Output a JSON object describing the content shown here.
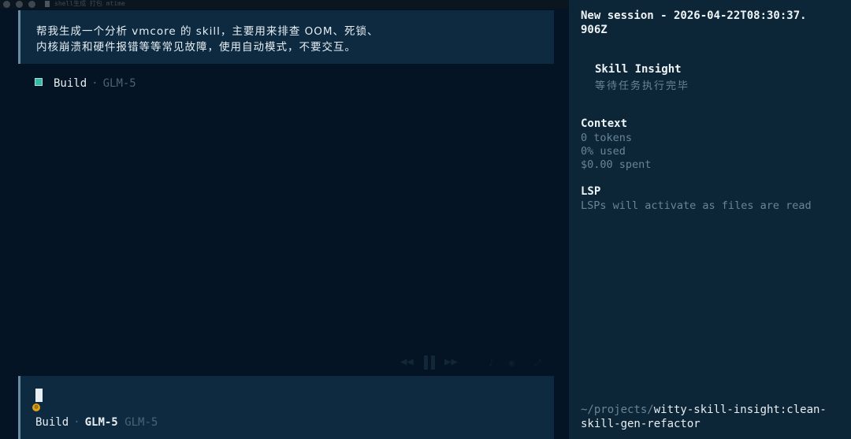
{
  "window": {
    "tab_title": "shell生成 打包 mtime"
  },
  "conversation": {
    "prompt_line1": "帮我生成一个分析 vmcore 的 skill，主要用来排查 OOM、死锁、",
    "prompt_line2": "内核崩溃和硬件报错等等常见故障，使用自动模式，不要交互。",
    "agent_mode": "Build",
    "separator": "·",
    "model": "GLM-5"
  },
  "input": {
    "mode": "Build",
    "separator": "·",
    "model": "GLM-5",
    "model_alt": "GLM-5"
  },
  "sidebar": {
    "session_title_line1": "New session - 2026-04-22T08:30:37.",
    "session_title_line2": "906Z",
    "insight_title": "Skill Insight",
    "insight_status": "等待任务执行完毕",
    "context_heading": "Context",
    "context_tokens": "0 tokens",
    "context_used": "0% used",
    "context_spent": "$0.00 spent",
    "lsp_heading": "LSP",
    "lsp_status": "LSPs will activate as files are read",
    "path_prefix": "~/projects/",
    "path_repo_line1": "witty-skill-insight:clean-",
    "path_repo_line2": "skill-gen-refactor"
  },
  "colors": {
    "main_bg": "#041424",
    "sidebar_bg": "#0c2638",
    "block_bg": "#0d2a40",
    "accent_teal": "#39b8a8",
    "accent_amber": "#e0a21b"
  }
}
